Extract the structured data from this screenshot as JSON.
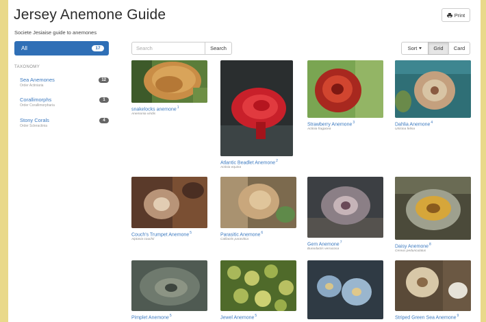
{
  "header": {
    "title": "Jersey Anemone Guide",
    "subtitle": "Societe Jesiaise guide to anemones",
    "print_label": "Print"
  },
  "sidebar": {
    "all": {
      "label": "All",
      "count": "17"
    },
    "section_label": "TAXONOMY",
    "items": [
      {
        "label": "Sea Anemones",
        "order": "Order Actiniaria",
        "count": "12"
      },
      {
        "label": "Corallimorphs",
        "order": "Order Corallimorpharia",
        "count": "1"
      },
      {
        "label": "Stony Corals",
        "order": "Order Scleractinia",
        "count": "4"
      }
    ]
  },
  "toolbar": {
    "search_placeholder": "Search",
    "search_button": "Search",
    "sort_label": "Sort",
    "grid_label": "Grid",
    "card_label": "Card",
    "active_view": "Grid"
  },
  "gallery": [
    {
      "name": "snakelocks anemone",
      "num": "1",
      "sci": "Anemonia viridis"
    },
    {
      "name": "Atlantic Beadlet Anemone",
      "num": "2",
      "sci": "Actinia equina"
    },
    {
      "name": "Strawberry Anemone",
      "num": "3",
      "sci": "Actinia fragacea"
    },
    {
      "name": "Dahlia Anemone",
      "num": "4",
      "sci": "Urticina felina"
    },
    {
      "name": "Couch's Trumpet Anemone",
      "num": "5",
      "sci": "Aiptasia couchii"
    },
    {
      "name": "Parasitic Anemone",
      "num": "6",
      "sci": "Calliactis parasitica"
    },
    {
      "name": "Gem Anemone",
      "num": "7",
      "sci": "Bunodactis verrucosa"
    },
    {
      "name": "Daisy Anemone",
      "num": "8",
      "sci": "Cereus pedunculatus"
    },
    {
      "name": "Pimplet Anemone",
      "num": "5",
      "sci": ""
    },
    {
      "name": "Jewel Anemone",
      "num": "5",
      "sci": ""
    },
    {
      "name": "",
      "num": "",
      "sci": ""
    },
    {
      "name": "Striped Green Sea Anemone",
      "num": "9",
      "sci": ""
    }
  ],
  "colors": {
    "accent": "#2f6fb6",
    "link": "#3a78bf",
    "frame": "#e9d98a"
  },
  "icons": {
    "print": "printer-icon",
    "sort_caret": "caret-down-icon"
  }
}
